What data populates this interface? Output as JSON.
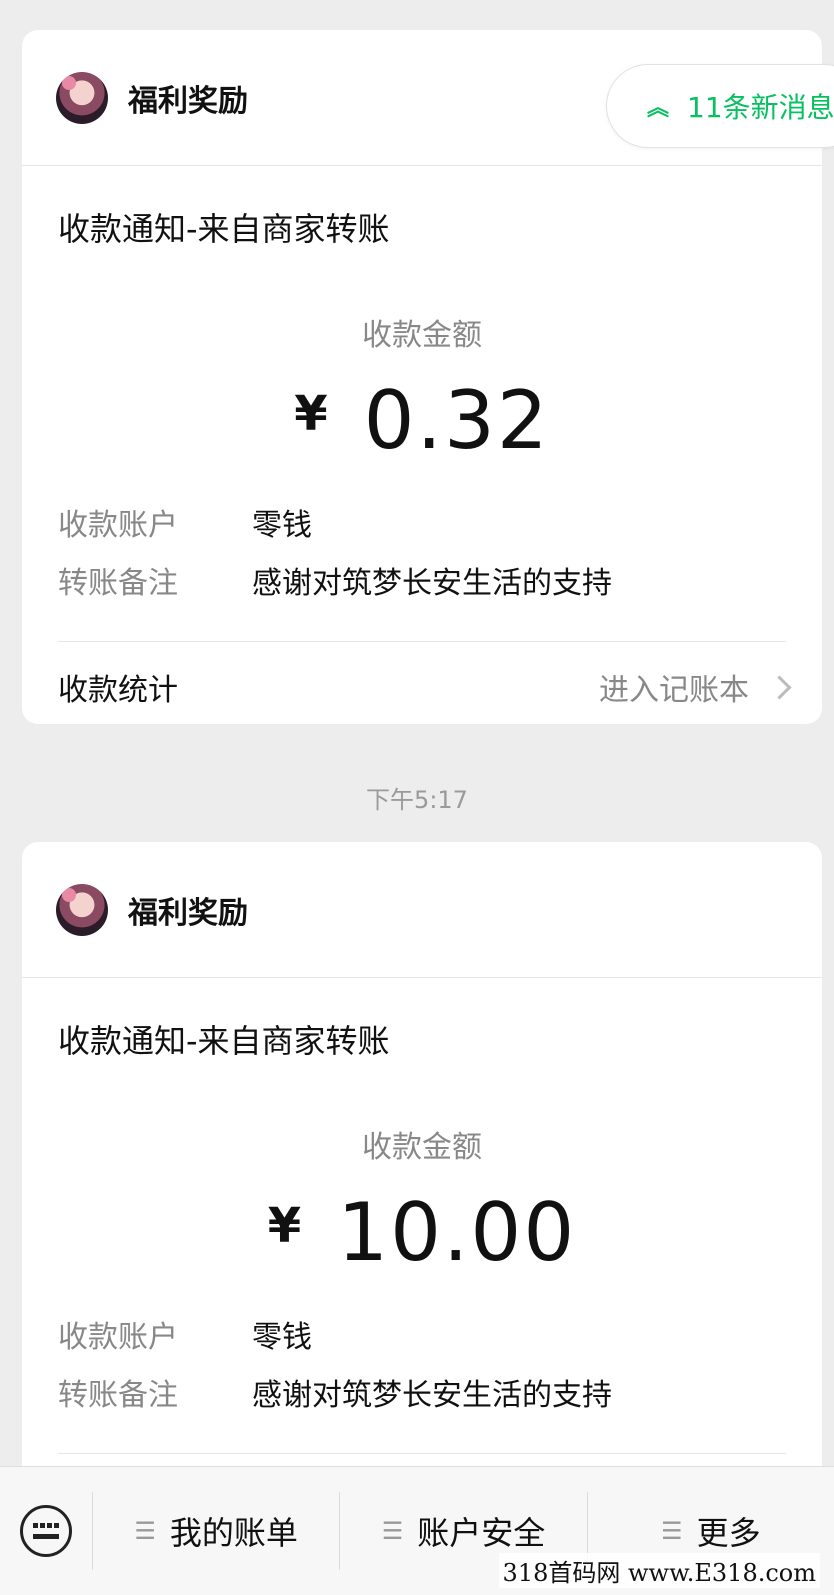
{
  "cards": [
    {
      "sender": "福利奖励",
      "title": "收款通知-来自商家转账",
      "amount_label": "收款金额",
      "currency": "¥",
      "amount": "0.32",
      "account_label": "收款账户",
      "account_value": "零钱",
      "remark_label": "转账备注",
      "remark_value": "感谢对筑梦长安生活的支持",
      "stats_label": "收款统计",
      "stats_link": "进入记账本"
    },
    {
      "sender": "福利奖励",
      "title": "收款通知-来自商家转账",
      "amount_label": "收款金额",
      "currency": "¥",
      "amount": "10.00",
      "account_label": "收款账户",
      "account_value": "零钱",
      "remark_label": "转账备注",
      "remark_value": "感谢对筑梦长安生活的支持"
    }
  ],
  "new_messages": {
    "icon": "double-chevron-up-icon",
    "label": "11条新消息"
  },
  "timestamp": "下午5:17",
  "bottom_menu": {
    "keyboard_icon": "keyboard-icon",
    "items": [
      "我的账单",
      "账户安全",
      "更多"
    ]
  },
  "watermark": "318首码网 www.E318.com",
  "colors": {
    "accent": "#07c160",
    "background": "#ededed"
  }
}
